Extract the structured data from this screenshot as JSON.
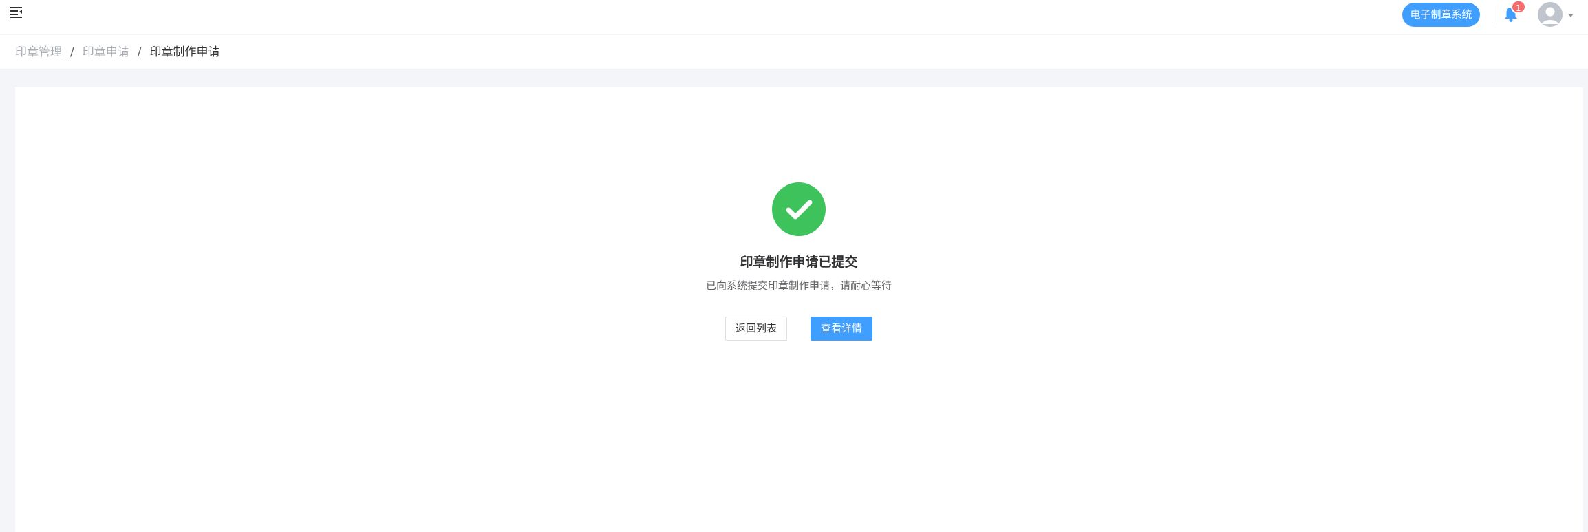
{
  "header": {
    "menu_icon": "hamburger-fold-icon",
    "system_badge": "电子制章系统",
    "notification_count": "1",
    "bell_icon": "bell-icon",
    "avatar_icon": "user-avatar-icon",
    "caret_icon": "caret-down-icon"
  },
  "breadcrumb": {
    "items": [
      "印章管理",
      "印章申请",
      "印章制作申请"
    ],
    "separator": "/"
  },
  "result": {
    "icon": "check-circle-icon",
    "status_color": "#3dc25c",
    "title": "印章制作申请已提交",
    "subtitle": "已向系统提交印章制作申请，请耐心等待",
    "back_label": "返回列表",
    "detail_label": "查看详情"
  },
  "colors": {
    "primary": "#409eff",
    "badge": "#f56c6c"
  }
}
